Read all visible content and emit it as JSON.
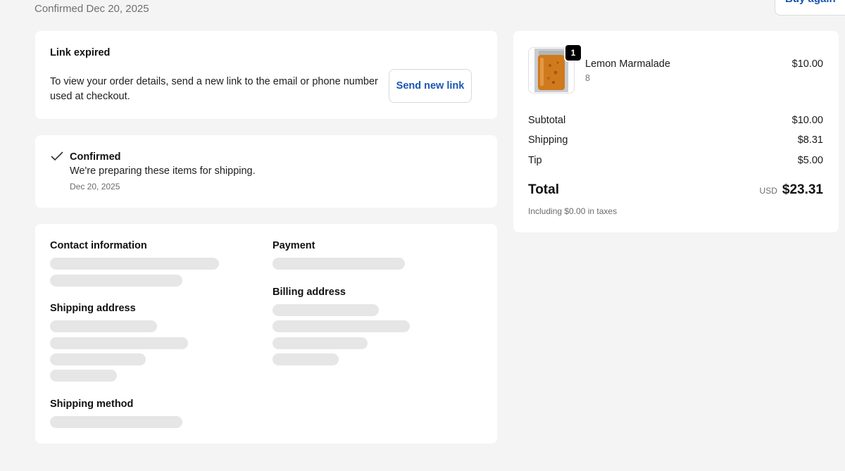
{
  "header": {
    "confirmed_date": "Confirmed Dec 20, 2025",
    "buy_again_label": "Buy again"
  },
  "link_expired": {
    "title": "Link expired",
    "text": "To view your order details, send a new link to the email or phone number used at checkout.",
    "button_label": "Send new link"
  },
  "status": {
    "icon": "check-icon",
    "title": "Confirmed",
    "text": "We're preparing these items for shipping.",
    "date": "Dec 20, 2025"
  },
  "details": {
    "contact_heading": "Contact information",
    "payment_heading": "Payment",
    "billing_heading": "Billing address",
    "shipping_address_heading": "Shipping address",
    "shipping_method_heading": "Shipping method"
  },
  "summary": {
    "item": {
      "name": "Lemon Marmalade",
      "variant": "8",
      "price": "$10.00",
      "quantity": "1"
    },
    "subtotal_label": "Subtotal",
    "subtotal_value": "$10.00",
    "shipping_label": "Shipping",
    "shipping_value": "$8.31",
    "tip_label": "Tip",
    "tip_value": "$5.00",
    "total_label": "Total",
    "currency": "USD",
    "total_value": "$23.31",
    "tax_note": "Including $0.00 in taxes"
  },
  "colors": {
    "accent": "#1a56b3",
    "background": "#f4f4f4",
    "skeleton": "#e6e6e6"
  }
}
